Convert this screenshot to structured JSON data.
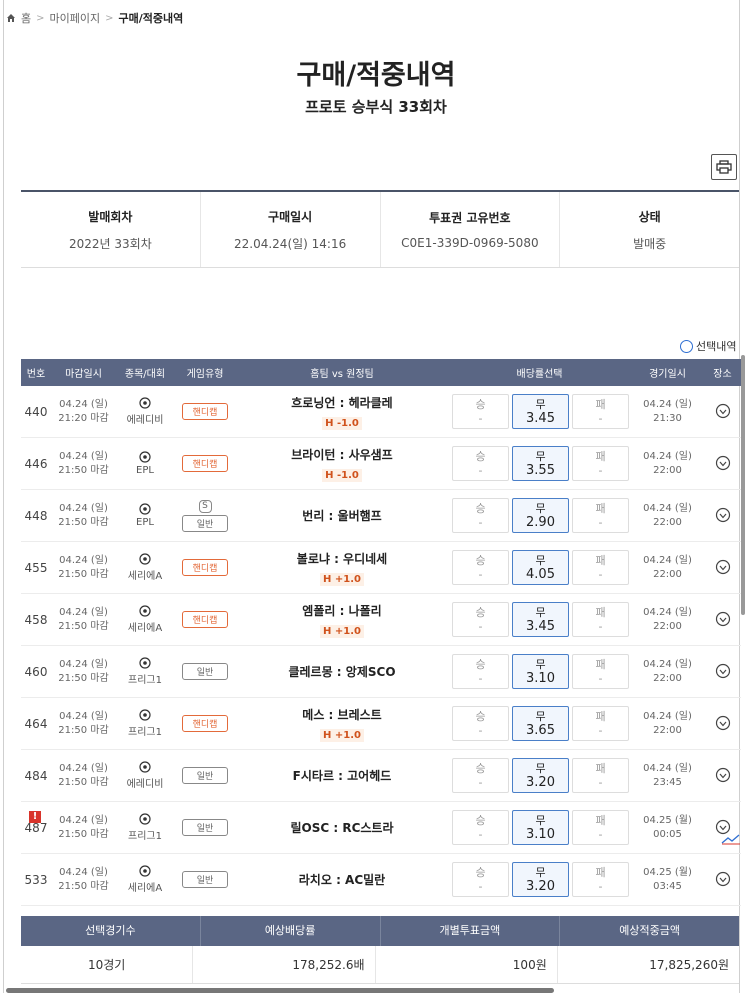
{
  "breadcrumb": {
    "home": "홈",
    "mypage": "마이페이지",
    "current": "구매/적중내역"
  },
  "page": {
    "title": "구매/적중내역",
    "subtitle": "프로토 승부식 33회차"
  },
  "info": [
    {
      "label": "발매회차",
      "value": "2022년 33회차"
    },
    {
      "label": "구매일시",
      "value": "22.04.24(일) 14:16"
    },
    {
      "label": "투표권 고유번호",
      "value": "C0E1-339D-0969-5080"
    },
    {
      "label": "상태",
      "value": "발매중"
    }
  ],
  "select_toggle": "선택내역",
  "table": {
    "headers": [
      "번호",
      "마감일시",
      "종목/대회",
      "게임유형",
      "홈팀 vs 원정팀",
      "배당률선택",
      "경기일시",
      "장소"
    ],
    "rows": [
      {
        "num": "440",
        "dl_date": "04.24 (일)",
        "dl_time": "21:20 마감",
        "league": "에레디비",
        "type": "핸디캡",
        "match": "흐로닝언 : 헤라클레",
        "handicap": "H -1.0",
        "win": "승",
        "win_v": "-",
        "draw": "무",
        "draw_v": "3.45",
        "lose": "패",
        "lose_v": "-",
        "g_date": "04.24 (일)",
        "g_time": "21:30"
      },
      {
        "num": "446",
        "dl_date": "04.24 (일)",
        "dl_time": "21:50 마감",
        "league": "EPL",
        "type": "핸디캡",
        "match": "브라이턴 : 사우샘프",
        "handicap": "H -1.0",
        "win": "승",
        "win_v": "-",
        "draw": "무",
        "draw_v": "3.55",
        "lose": "패",
        "lose_v": "-",
        "g_date": "04.24 (일)",
        "g_time": "22:00"
      },
      {
        "num": "448",
        "dl_date": "04.24 (일)",
        "dl_time": "21:50 마감",
        "league": "EPL",
        "type": "일반",
        "s_mark": "S",
        "match": "번리 : 울버햄프",
        "handicap": "",
        "win": "승",
        "win_v": "-",
        "draw": "무",
        "draw_v": "2.90",
        "lose": "패",
        "lose_v": "-",
        "g_date": "04.24 (일)",
        "g_time": "22:00"
      },
      {
        "num": "455",
        "dl_date": "04.24 (일)",
        "dl_time": "21:50 마감",
        "league": "세리에A",
        "type": "핸디캡",
        "match": "볼로냐 : 우디네세",
        "handicap": "H +1.0",
        "win": "승",
        "win_v": "-",
        "draw": "무",
        "draw_v": "4.05",
        "lose": "패",
        "lose_v": "-",
        "g_date": "04.24 (일)",
        "g_time": "22:00"
      },
      {
        "num": "458",
        "dl_date": "04.24 (일)",
        "dl_time": "21:50 마감",
        "league": "세리에A",
        "type": "핸디캡",
        "match": "엠폴리 : 나폴리",
        "handicap": "H +1.0",
        "win": "승",
        "win_v": "-",
        "draw": "무",
        "draw_v": "3.45",
        "lose": "패",
        "lose_v": "-",
        "g_date": "04.24 (일)",
        "g_time": "22:00"
      },
      {
        "num": "460",
        "dl_date": "04.24 (일)",
        "dl_time": "21:50 마감",
        "league": "프리그1",
        "type": "일반",
        "match": "클레르몽 : 앙제SCO",
        "handicap": "",
        "win": "승",
        "win_v": "-",
        "draw": "무",
        "draw_v": "3.10",
        "lose": "패",
        "lose_v": "-",
        "g_date": "04.24 (일)",
        "g_time": "22:00"
      },
      {
        "num": "464",
        "dl_date": "04.24 (일)",
        "dl_time": "21:50 마감",
        "league": "프리그1",
        "type": "핸디캡",
        "match": "메스 : 브레스트",
        "handicap": "H +1.0",
        "win": "승",
        "win_v": "-",
        "draw": "무",
        "draw_v": "3.65",
        "lose": "패",
        "lose_v": "-",
        "g_date": "04.24 (일)",
        "g_time": "22:00"
      },
      {
        "num": "484",
        "dl_date": "04.24 (일)",
        "dl_time": "21:50 마감",
        "league": "에레디비",
        "type": "일반",
        "match": "F시타르 : 고어헤드",
        "handicap": "",
        "win": "승",
        "win_v": "-",
        "draw": "무",
        "draw_v": "3.20",
        "lose": "패",
        "lose_v": "-",
        "g_date": "04.24 (일)",
        "g_time": "23:45"
      },
      {
        "num": "487",
        "alert": "!",
        "dl_date": "04.24 (일)",
        "dl_time": "21:50 마감",
        "league": "프리그1",
        "type": "일반",
        "match": "릴OSC : RC스트라",
        "handicap": "",
        "win": "승",
        "win_v": "-",
        "draw": "무",
        "draw_v": "3.10",
        "lose": "패",
        "lose_v": "-",
        "g_date": "04.25 (월)",
        "g_time": "00:05",
        "chart_icon": true
      },
      {
        "num": "533",
        "dl_date": "04.24 (일)",
        "dl_time": "21:50 마감",
        "league": "세리에A",
        "type": "일반",
        "match": "라치오 : AC밀란",
        "handicap": "",
        "win": "승",
        "win_v": "-",
        "draw": "무",
        "draw_v": "3.20",
        "lose": "패",
        "lose_v": "-",
        "g_date": "04.25 (월)",
        "g_time": "03:45"
      }
    ]
  },
  "summary": {
    "headers": [
      "선택경기수",
      "예상배당률",
      "개별투표금액",
      "예상적중금액"
    ],
    "values": [
      "10경기",
      "178,252.6배",
      "100원",
      "17,825,260원"
    ]
  },
  "colors": {
    "header_bg": "#5a6684",
    "handicap_badge": "#e36a3a",
    "selected_odd_border": "#4a7fc8",
    "alert": "#d9342b"
  },
  "icons": {
    "home": "home-icon",
    "print": "printer-icon",
    "sport": "soccer-ball-icon",
    "place": "map-pin-icon",
    "trend": "chart-trend-icon"
  }
}
